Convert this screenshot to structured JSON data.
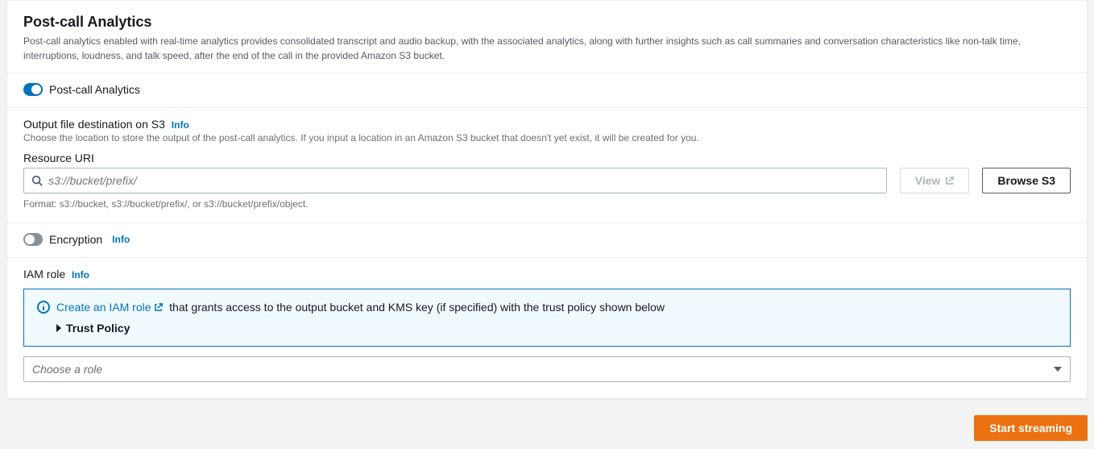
{
  "panel": {
    "title": "Post-call Analytics",
    "subtitle": "Post-call analytics enabled with real-time analytics provides consolidated transcript and audio backup, with the associated analytics, along with further insights such as call summaries and conversation characteristics like non-talk time, interruptions, loudness, and talk speed, after the end of the call in the provided Amazon S3 bucket."
  },
  "toggle_analytics": {
    "label": "Post-call Analytics",
    "on": true
  },
  "output": {
    "label": "Output file destination on S3",
    "info": "Info",
    "hint": "Choose the location to store the output of the post-call analytics. If you input a location in an Amazon S3 bucket that doesn't yet exist, it will be created for you.",
    "resource_label": "Resource URI",
    "placeholder": "s3://bucket/prefix/",
    "view_label": "View",
    "browse_label": "Browse S3",
    "format_hint": "Format: s3://bucket, s3://bucket/prefix/, or s3://bucket/prefix/object."
  },
  "encryption": {
    "label": "Encryption",
    "info": "Info",
    "on": false
  },
  "iam": {
    "label": "IAM role",
    "info": "Info",
    "alert_link": "Create an IAM role",
    "alert_text": "that grants access to the output bucket and KMS key (if specified) with the trust policy shown below",
    "trust_label": "Trust Policy",
    "select_placeholder": "Choose a role"
  },
  "footer": {
    "start_label": "Start streaming"
  }
}
